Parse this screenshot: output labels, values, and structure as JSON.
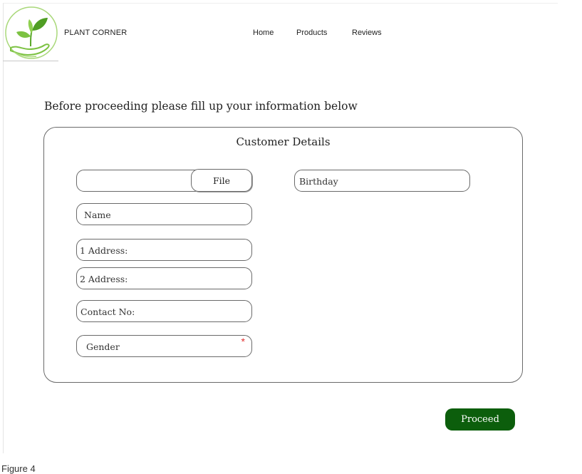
{
  "header": {
    "brand": "PLANT CORNER",
    "nav": [
      {
        "label": "Home"
      },
      {
        "label": "Products"
      },
      {
        "label": "Reviews"
      }
    ],
    "logo_icon": "plant-in-hand-logo"
  },
  "intro_text": "Before proceeding please fill up your information below",
  "form": {
    "title": "Customer Details",
    "file_button": "File",
    "file_input_value": "",
    "fields": {
      "name": "Name",
      "address1": "1 Address:",
      "address2": "2 Address:",
      "contact": "Contact No:",
      "gender": "Gender",
      "birthday": "Birthday"
    },
    "required_marker": "*"
  },
  "proceed_label": "Proceed",
  "caption": "Figure 4",
  "colors": {
    "accent": "#0c5e0c",
    "logo_green": "#7cc242",
    "required": "#e03030"
  }
}
